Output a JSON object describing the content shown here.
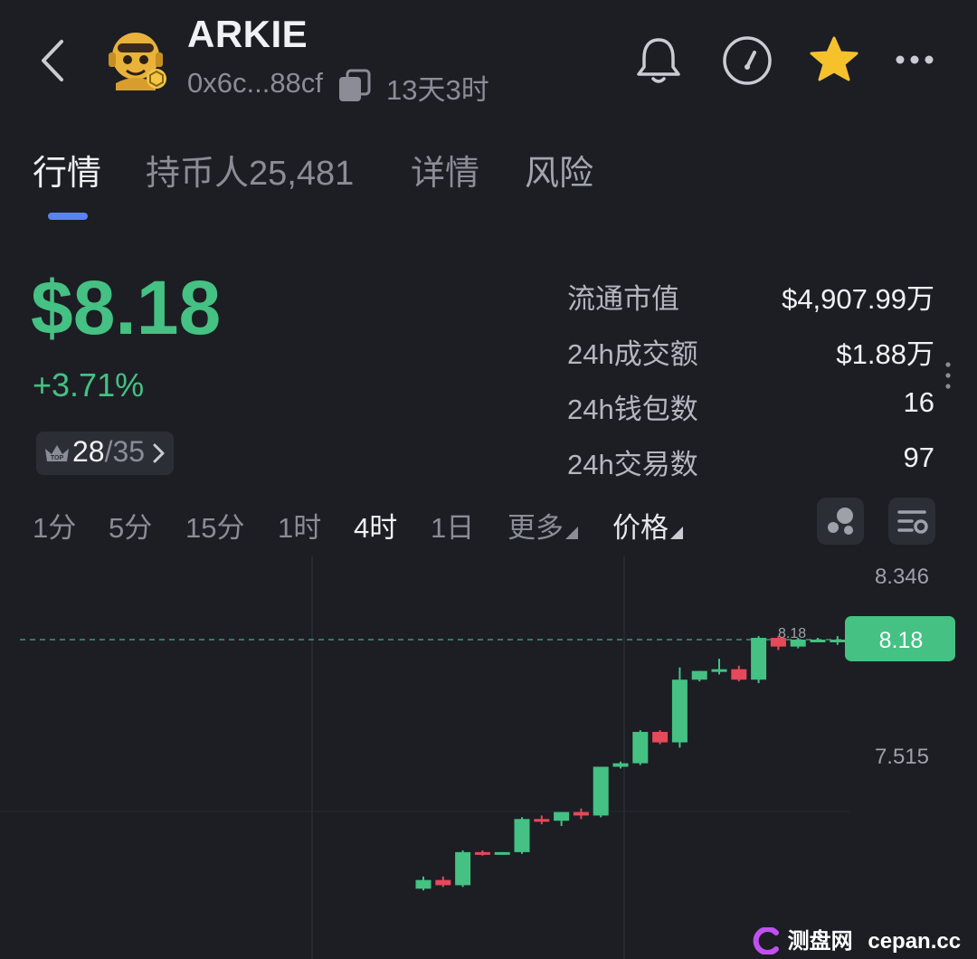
{
  "header": {
    "title": "ARKIE",
    "address": "0x6c...88cf",
    "age": "13天3时"
  },
  "tabs": [
    {
      "label": "行情",
      "active": true
    },
    {
      "label": "持币人25,481",
      "active": false
    },
    {
      "label": "详情",
      "active": false
    },
    {
      "label": "风险",
      "active": false
    }
  ],
  "price": {
    "value": "$8.18",
    "change": "+3.71%",
    "rank_current": "28",
    "rank_total": "/35",
    "rank_badge_text": "TOP"
  },
  "stats": [
    {
      "label": "流通市值",
      "value": "$4,907.99万"
    },
    {
      "label": "24h成交额",
      "value": "$1.88万"
    },
    {
      "label": "24h钱包数",
      "value": "16"
    },
    {
      "label": "24h交易数",
      "value": "97"
    }
  ],
  "intervals": [
    {
      "label": "1分",
      "active": false
    },
    {
      "label": "5分",
      "active": false
    },
    {
      "label": "15分",
      "active": false
    },
    {
      "label": "1时",
      "active": false
    },
    {
      "label": "4时",
      "active": true
    },
    {
      "label": "1日",
      "active": false
    },
    {
      "label": "更多",
      "active": false
    },
    {
      "label": "价格",
      "active": false
    }
  ],
  "colors": {
    "up": "#44c183",
    "down": "#e5495a",
    "accent": "#5b82f0",
    "star": "#f6c22c",
    "background": "#1c1e24"
  },
  "icons": [
    "back-icon",
    "avatar-icon",
    "copy-icon",
    "bell-icon",
    "speedometer-icon",
    "star-icon",
    "more-icon",
    "crown-icon",
    "chevron-right-icon",
    "indicator-icon",
    "chart-settings-icon"
  ],
  "chart_data": {
    "type": "candlestick",
    "interval": "4时",
    "y_ticks": [
      "8.346",
      "7.515"
    ],
    "current_price_label": "8.18",
    "last_price_marker": "8.18",
    "ylim": [
      6.75,
      8.48
    ],
    "candles": [
      {
        "open": 6.75,
        "high": 6.82,
        "low": 6.74,
        "close": 6.8
      },
      {
        "open": 6.8,
        "high": 6.82,
        "low": 6.76,
        "close": 6.77
      },
      {
        "open": 6.77,
        "high": 6.97,
        "low": 6.76,
        "close": 6.96
      },
      {
        "open": 6.96,
        "high": 6.97,
        "low": 6.94,
        "close": 6.95
      },
      {
        "open": 6.95,
        "high": 6.96,
        "low": 6.95,
        "close": 6.96
      },
      {
        "open": 6.96,
        "high": 7.16,
        "low": 6.95,
        "close": 7.15
      },
      {
        "open": 7.15,
        "high": 7.17,
        "low": 7.12,
        "close": 7.14
      },
      {
        "open": 7.14,
        "high": 7.19,
        "low": 7.11,
        "close": 7.19
      },
      {
        "open": 7.19,
        "high": 7.21,
        "low": 7.15,
        "close": 7.17
      },
      {
        "open": 7.17,
        "high": 7.45,
        "low": 7.16,
        "close": 7.45
      },
      {
        "open": 7.45,
        "high": 7.48,
        "low": 7.44,
        "close": 7.47
      },
      {
        "open": 7.47,
        "high": 7.66,
        "low": 7.46,
        "close": 7.65
      },
      {
        "open": 7.65,
        "high": 7.66,
        "low": 7.58,
        "close": 7.59
      },
      {
        "open": 7.59,
        "high": 8.02,
        "low": 7.56,
        "close": 7.95
      },
      {
        "open": 7.95,
        "high": 8.0,
        "low": 7.94,
        "close": 8.0
      },
      {
        "open": 8.0,
        "high": 8.07,
        "low": 7.98,
        "close": 8.01
      },
      {
        "open": 8.01,
        "high": 8.03,
        "low": 7.94,
        "close": 7.95
      },
      {
        "open": 7.95,
        "high": 8.2,
        "low": 7.93,
        "close": 8.19
      },
      {
        "open": 8.19,
        "high": 8.2,
        "low": 8.12,
        "close": 8.14
      },
      {
        "open": 8.14,
        "high": 8.19,
        "low": 8.13,
        "close": 8.18
      },
      {
        "open": 8.18,
        "high": 8.19,
        "low": 8.17,
        "close": 8.18
      },
      {
        "open": 8.18,
        "high": 8.2,
        "low": 8.15,
        "close": 8.18
      }
    ]
  },
  "watermark": {
    "brand": "测盘网",
    "domain": "cepan.cc"
  }
}
